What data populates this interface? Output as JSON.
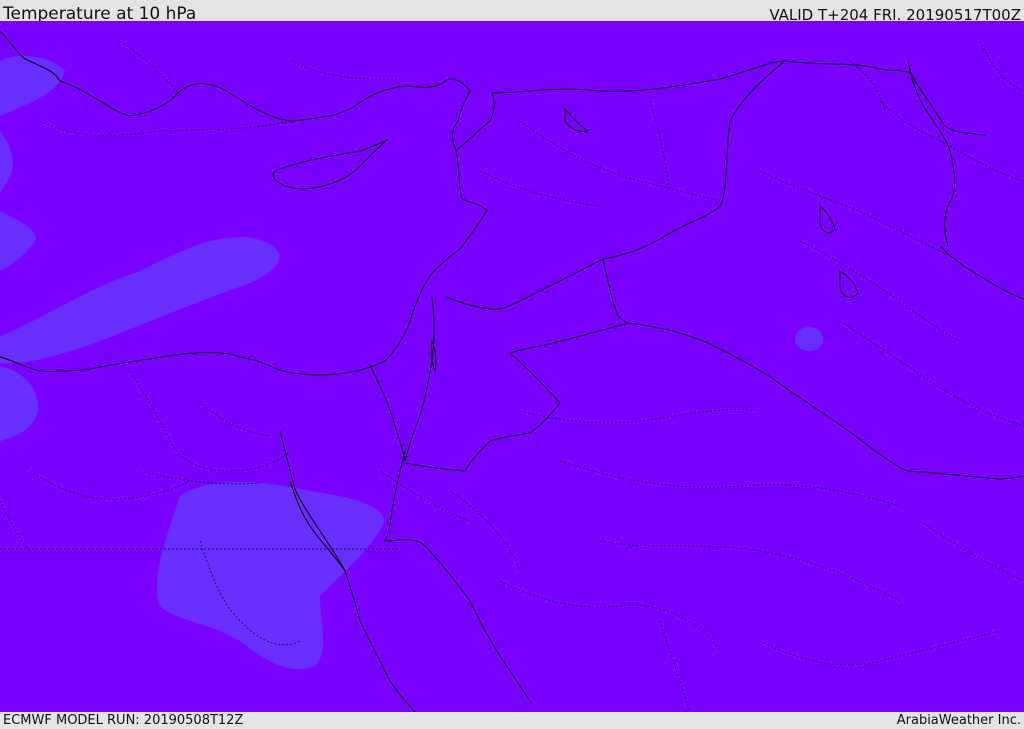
{
  "header": {
    "title": "Temperature at 10 hPa",
    "valid_time": "VALID T+204 FRI. 20190517T00Z"
  },
  "footer": {
    "model_run": "ECMWF MODEL RUN: 20190508T12Z",
    "credit": "ArabiaWeather Inc."
  },
  "map": {
    "field": "temperature",
    "level": "10 hPa",
    "background_color": "#7a00ff",
    "warm_patch_color": "#6a22ff",
    "coastline_color": "#000000"
  }
}
